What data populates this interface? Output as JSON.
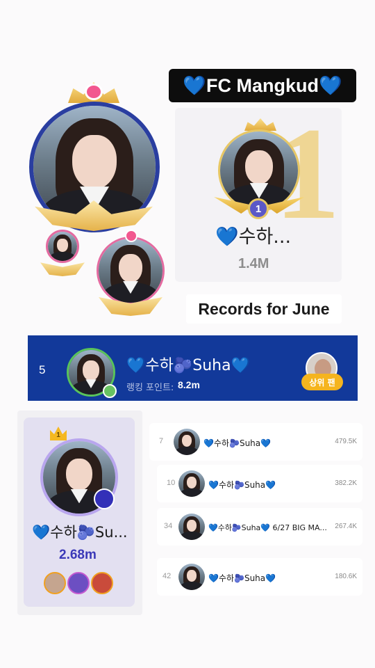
{
  "banner": {
    "title": "💙FC Mangkud💙"
  },
  "top_rank": {
    "rank": "1",
    "big_number": "1",
    "name": "💙수하...",
    "score": "1.4M"
  },
  "records_label": "Records for June",
  "highlight_row": {
    "rank": "5",
    "name": "💙수하🫐Suha💙",
    "points_label": "랭킹 포인트:",
    "points_value": "8.2m",
    "top_fan_label": "상위 팬"
  },
  "profile": {
    "crown_rank": "1",
    "name": "💙수하🫐Su...",
    "score": "2.68m"
  },
  "list": [
    {
      "rank": "7",
      "name": "💙수하🫐Suha💙",
      "value": "479.5K"
    },
    {
      "rank": "10",
      "name": "💙수하🫐Suha💙",
      "value": "382.2K"
    },
    {
      "rank": "34",
      "name": "💙수하🫐Suha💙 6/27 BIG MA...",
      "value": "267.4K"
    },
    {
      "rank": "42",
      "name": "💙수하🫐Suha💙",
      "value": "180.6K"
    }
  ],
  "colors": {
    "accent_blue": "#12399a",
    "gold": "#efd694",
    "purple": "#3b39b8"
  }
}
